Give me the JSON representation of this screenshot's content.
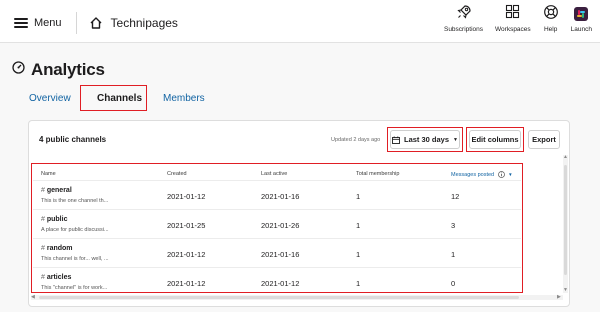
{
  "topbar": {
    "menu_label": "Menu",
    "site_name": "Technipages",
    "items": [
      {
        "label": "Subscriptions",
        "icon": "rocket-icon"
      },
      {
        "label": "Workspaces",
        "icon": "grid-icon"
      },
      {
        "label": "Help",
        "icon": "lifebuoy-icon"
      },
      {
        "label": "Launch",
        "icon": "slack-logo-icon"
      }
    ]
  },
  "page": {
    "title": "Analytics"
  },
  "tabs": [
    {
      "label": "Overview",
      "active": false
    },
    {
      "label": "Channels",
      "active": true
    },
    {
      "label": "Members",
      "active": false
    }
  ],
  "card": {
    "title": "4 public channels",
    "updated": "Updated 2 days ago",
    "date_range_label": "Last 30 days",
    "edit_columns_label": "Edit columns",
    "export_label": "Export"
  },
  "table": {
    "columns": [
      "Name",
      "Created",
      "Last active",
      "Total membership",
      "Messages posted"
    ],
    "sorted_column": "Messages posted",
    "rows": [
      {
        "hash": "#",
        "name": "general",
        "desc": "This is the one channel th...",
        "created": "2021-01-12",
        "last_active": "2021-01-16",
        "membership": "1",
        "messages": "12"
      },
      {
        "hash": "#",
        "name": "public",
        "desc": "A place for public discussi...",
        "created": "2021-01-25",
        "last_active": "2021-01-26",
        "membership": "1",
        "messages": "3"
      },
      {
        "hash": "#",
        "name": "random",
        "desc": "This channel is for... well, ...",
        "created": "2021-01-12",
        "last_active": "2021-01-16",
        "membership": "1",
        "messages": "1"
      },
      {
        "hash": "#",
        "name": "articles",
        "desc": "This \"channel\" is for work...",
        "created": "2021-01-12",
        "last_active": "2021-01-12",
        "membership": "1",
        "messages": "0"
      }
    ]
  },
  "colors": {
    "highlight": "#e01e24",
    "link": "#1264a3",
    "launch_bg": "#3b1f3f"
  }
}
